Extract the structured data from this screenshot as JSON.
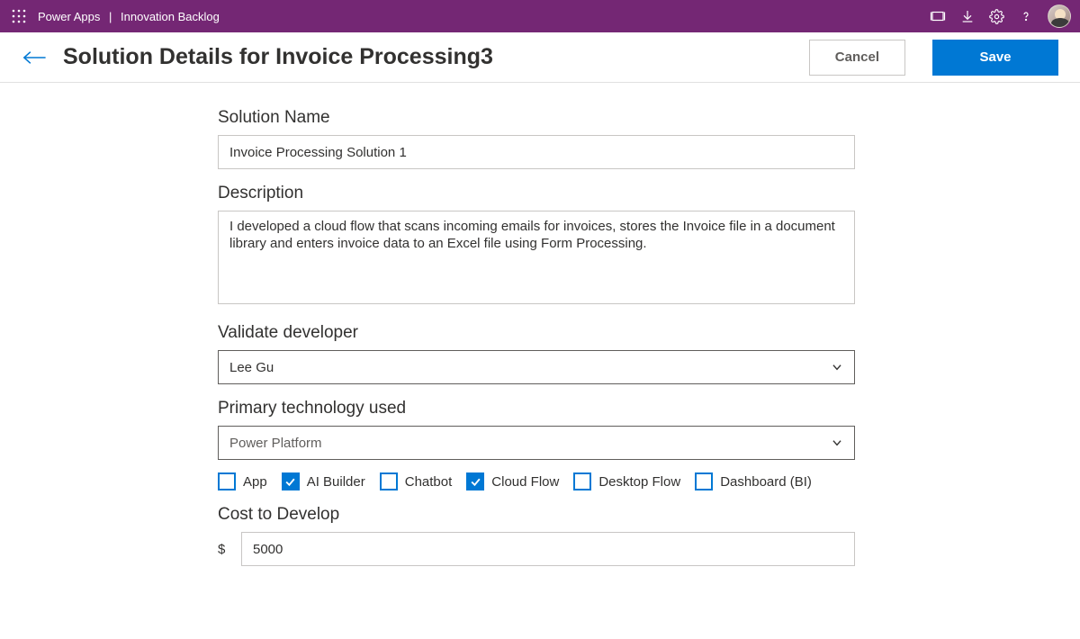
{
  "topbar": {
    "app": "Power Apps",
    "separator": "|",
    "page": "Innovation Backlog"
  },
  "header": {
    "title": "Solution Details for Invoice Processing3",
    "cancel": "Cancel",
    "save": "Save"
  },
  "form": {
    "solutionName": {
      "label": "Solution Name",
      "value": "Invoice Processing Solution 1"
    },
    "description": {
      "label": "Description",
      "value": "I developed a cloud flow that scans incoming emails for invoices, stores the Invoice file in a document library and enters invoice data to an Excel file using Form Processing."
    },
    "validateDeveloper": {
      "label": "Validate developer",
      "value": "Lee Gu"
    },
    "primaryTech": {
      "label": "Primary technology used",
      "value": "Power Platform",
      "options": [
        {
          "label": "App",
          "checked": false
        },
        {
          "label": "AI Builder",
          "checked": true
        },
        {
          "label": "Chatbot",
          "checked": false
        },
        {
          "label": "Cloud Flow",
          "checked": true
        },
        {
          "label": "Desktop Flow",
          "checked": false
        },
        {
          "label": "Dashboard (BI)",
          "checked": false
        }
      ]
    },
    "cost": {
      "label": "Cost to Develop",
      "currency": "$",
      "value": "5000"
    }
  }
}
